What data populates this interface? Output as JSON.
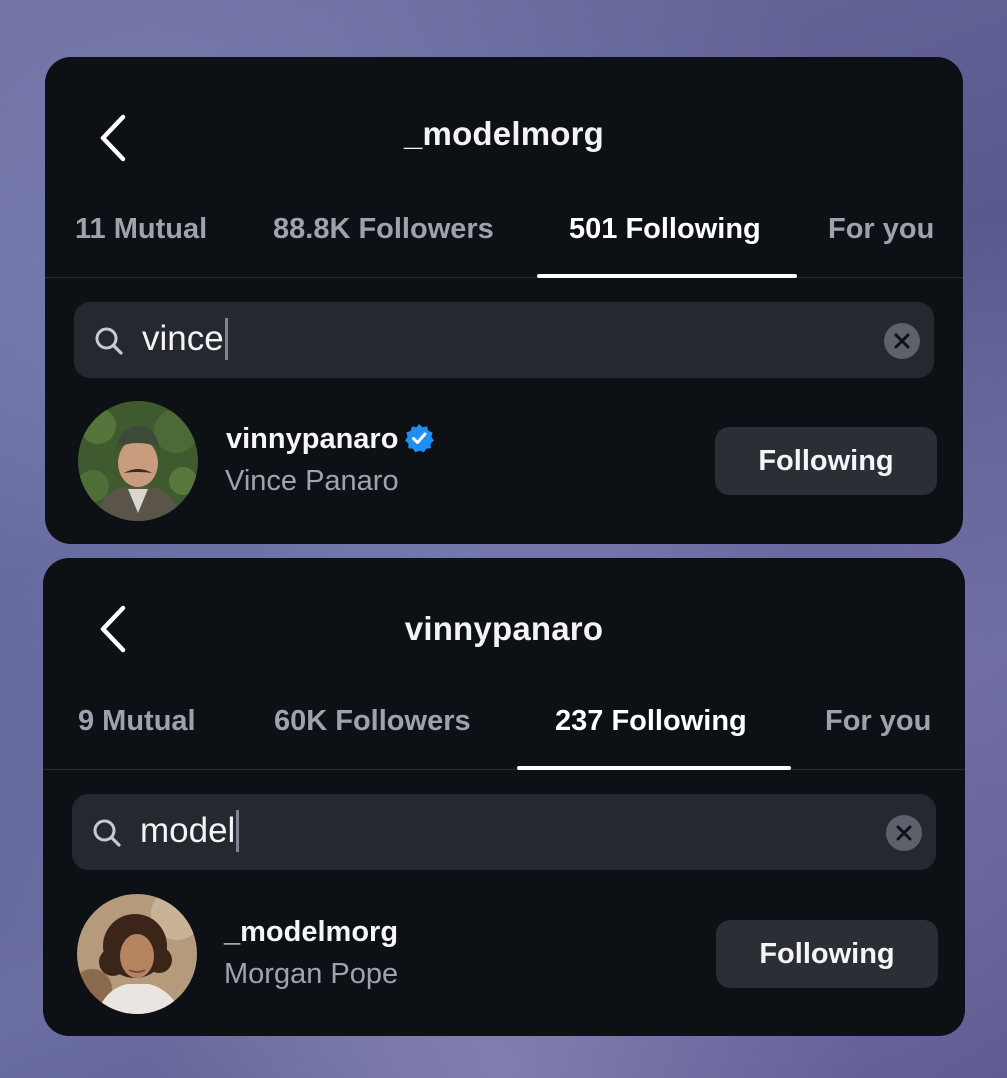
{
  "panels": [
    {
      "title": "_modelmorg",
      "tabs": [
        {
          "label": "11 Mutual"
        },
        {
          "label": "88.8K Followers"
        },
        {
          "label": "501 Following"
        },
        {
          "label": "For you"
        }
      ],
      "active_tab": 2,
      "search": {
        "query": "vince"
      },
      "result": {
        "username": "vinnypanaro",
        "verified": true,
        "full_name": "Vince Panaro",
        "button_label": "Following"
      }
    },
    {
      "title": "vinnypanaro",
      "tabs": [
        {
          "label": "9 Mutual"
        },
        {
          "label": "60K Followers"
        },
        {
          "label": "237 Following"
        },
        {
          "label": "For you"
        }
      ],
      "active_tab": 2,
      "search": {
        "query": "model"
      },
      "result": {
        "username": "_modelmorg",
        "verified": false,
        "full_name": "Morgan Pope",
        "button_label": "Following"
      }
    }
  ],
  "colors": {
    "card_bg": "#0d1015",
    "search_bg": "#25282e",
    "button_bg": "#2b2e35",
    "verified_blue": "#1f8ff5"
  }
}
